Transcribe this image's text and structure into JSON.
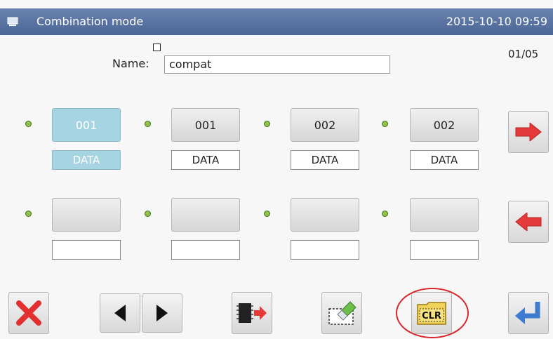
{
  "window": {
    "title": "Combination mode",
    "datetime": "2015-10-10 09:59"
  },
  "name": {
    "label": "Name:",
    "value": "compat"
  },
  "page_indicator": "01/05",
  "rows": [
    {
      "patterns": [
        {
          "number": "001",
          "data_label": "DATA",
          "selected": true
        },
        {
          "number": "001",
          "data_label": "DATA",
          "selected": false
        },
        {
          "number": "002",
          "data_label": "DATA",
          "selected": false
        },
        {
          "number": "002",
          "data_label": "DATA",
          "selected": false
        }
      ]
    },
    {
      "patterns": [
        {
          "number": "",
          "data_label": "",
          "selected": false
        },
        {
          "number": "",
          "data_label": "",
          "selected": false
        },
        {
          "number": "",
          "data_label": "",
          "selected": false
        },
        {
          "number": "",
          "data_label": "",
          "selected": false
        }
      ]
    }
  ],
  "toolbar": {
    "clear_label": "CLR"
  },
  "icons": {
    "window": "window-icon",
    "status": "status-dot-icon",
    "next_page": "arrow-right-icon",
    "prev_page": "arrow-left-icon",
    "cancel": "close-icon",
    "nav_left": "triangle-left-icon",
    "nav_right": "triangle-right-icon",
    "write": "chip-write-icon",
    "erase": "eraser-icon",
    "clear": "clear-icon",
    "enter": "enter-icon"
  },
  "colors": {
    "title_bar": "#5673a6",
    "selected": "#a6d4e3",
    "status_dot": "#8fc34a",
    "highlight_ring": "#d8262b",
    "arrow": "#e53a3a",
    "enter": "#3e7bd1"
  }
}
